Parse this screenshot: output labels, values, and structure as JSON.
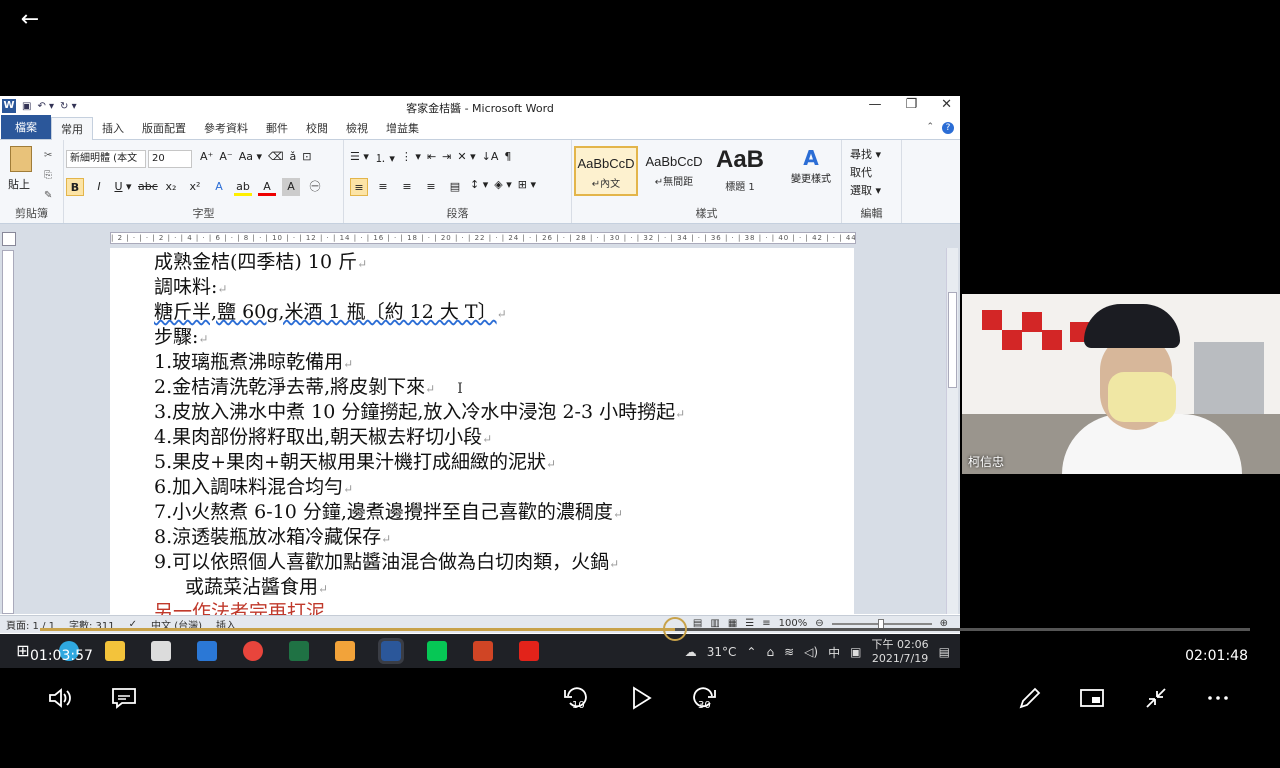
{
  "word": {
    "title": "客家金桔醬 - Microsoft Word",
    "tabs": [
      "檔案",
      "常用",
      "插入",
      "版面配置",
      "參考資料",
      "郵件",
      "校閱",
      "檢視",
      "增益集"
    ],
    "active_tab": "常用",
    "ribbon": {
      "paste_label": "貼上",
      "font_name": "新細明體 (本文",
      "font_size": "20",
      "styles": [
        {
          "sample": "AaBbCcD",
          "name": "↵內文"
        },
        {
          "sample": "AaBbCcD",
          "name": "↵無間距"
        },
        {
          "sample": "AaB",
          "name": "標題 1"
        }
      ],
      "change_styles": "變更樣式",
      "edit_items": [
        "尋找 ▾",
        "取代",
        "選取 ▾"
      ],
      "group_labels": [
        "剪貼簿",
        "字型",
        "段落",
        "樣式",
        "編輯"
      ]
    },
    "ruler_text": "| 2 | · | · | 2 | · | 4 | · | 6 | · | 8 | · | 10 | · | 12 | · | 14 | · | 16 | · | 18 | · | 20 | · | 22 | · | 24 | · | 26 | · | 28 | · | 30 | · | 32 | · | 34 | · | 36 | · | 38 | · | 40 | · | 42 | · | 44 | · | 46 |",
    "doc_lines": [
      "成熟金桔(四季桔) 10 斤",
      "調味料:",
      "糖斤半,鹽 60g,米酒 1 瓶〔約 12 大 T〕",
      "步驟:",
      "1.玻璃瓶煮沸晾乾備用",
      "2.金桔清洗乾淨去蒂,將皮剝下來",
      "3.皮放入沸水中煮 10 分鐘撈起,放入冷水中浸泡 2-3 小時撈起",
      "4.果肉部份將籽取出,朝天椒去籽切小段",
      "5.果皮+果肉+朝天椒用果汁機打成細緻的泥狀",
      "6.加入調味料混合均勻",
      "7.小火熬煮 6-10 分鐘,邊煮邊攪拌至自己喜歡的濃稠度",
      "8.涼透裝瓶放冰箱冷藏保存",
      "9.可以依照個人喜歡加點醬油混合做為白切肉類，火鍋",
      "或蔬菜沾醬食用",
      "另一作法者完再打泥"
    ],
    "status": {
      "page": "頁面: 1 / 1",
      "words": "字數: 311",
      "lang": "中文 (台灣)",
      "mode": "插入",
      "zoom": "100%"
    }
  },
  "taskbar": {
    "weather": "31°C",
    "ime": "中",
    "time": "下午 02:06",
    "date": "2021/7/19",
    "apps": [
      "windows-start",
      "edge",
      "file-explorer",
      "store",
      "mail",
      "chrome",
      "excel",
      "media-player",
      "word",
      "line",
      "powerpoint",
      "acrobat"
    ]
  },
  "video": {
    "participant_name": "柯信忠"
  },
  "player": {
    "elapsed": "01:03:57",
    "total": "02:01:48",
    "progress": 0.525
  },
  "colors": {
    "progress": "#c8a24a",
    "word_blue": "#2b579a"
  }
}
